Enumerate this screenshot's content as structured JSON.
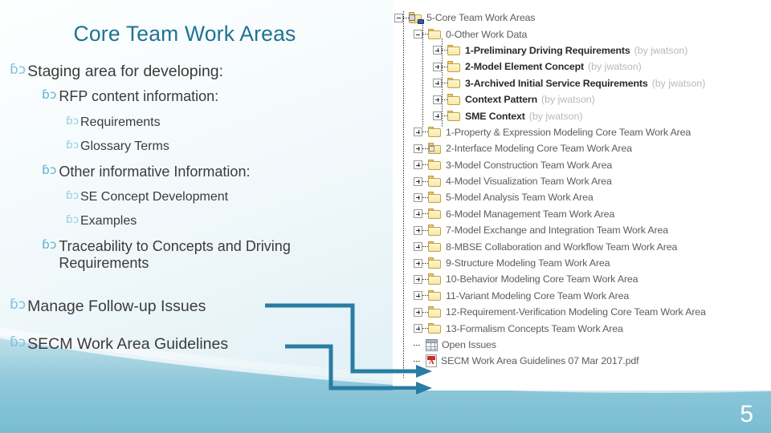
{
  "slide": {
    "title": "Core Team Work Areas",
    "page_number": "5",
    "bullet_glyph": "ɓↄ",
    "accent_color": "#1f7391",
    "connector_color": "#2a7ca3"
  },
  "outline": [
    {
      "level": 1,
      "text": "Staging area for developing:"
    },
    {
      "level": 2,
      "text": "RFP content information:"
    },
    {
      "level": 3,
      "text": "Requirements"
    },
    {
      "level": 3,
      "text": "Glossary Terms"
    },
    {
      "level": 2,
      "text": "Other informative Information:"
    },
    {
      "level": 3,
      "text": "SE Concept Development"
    },
    {
      "level": 3,
      "text": "Examples"
    },
    {
      "level": 2,
      "text": "Traceability to Concepts and Driving Requirements"
    },
    {
      "level": 1,
      "text": "Manage Follow-up Issues"
    },
    {
      "level": 1,
      "text": "SECM Work Area Guidelines"
    }
  ],
  "tree": {
    "rows": [
      {
        "indent": 0,
        "toggle": "minus",
        "icon": "folder-root",
        "label": "5-Core Team Work Areas",
        "by": "",
        "bold": false
      },
      {
        "indent": 1,
        "toggle": "minus",
        "icon": "folder",
        "label": "0-Other Work Data",
        "by": "",
        "bold": false
      },
      {
        "indent": 2,
        "toggle": "plus",
        "icon": "folder",
        "label": "1-Preliminary Driving Requirements",
        "by": "(by jwatson)",
        "bold": true
      },
      {
        "indent": 2,
        "toggle": "plus",
        "icon": "folder",
        "label": "2-Model Element Concept",
        "by": "(by jwatson)",
        "bold": true
      },
      {
        "indent": 2,
        "toggle": "plus",
        "icon": "folder",
        "label": "3-Archived Initial Service Requirements",
        "by": "(by jwatson)",
        "bold": true
      },
      {
        "indent": 2,
        "toggle": "plus",
        "icon": "folder",
        "label": "Context Pattern",
        "by": "(by jwatson)",
        "bold": true
      },
      {
        "indent": 2,
        "toggle": "plus",
        "icon": "folder",
        "label": "SME Context",
        "by": "(by jwatson)",
        "bold": true
      },
      {
        "indent": 1,
        "toggle": "plus",
        "icon": "folder",
        "label": "1-Property & Expression Modeling Core Team Work Area",
        "by": "",
        "bold": false
      },
      {
        "indent": 1,
        "toggle": "plus",
        "icon": "folder-special",
        "label": "2-Interface Modeling Core Team Work Area",
        "by": "",
        "bold": false
      },
      {
        "indent": 1,
        "toggle": "plus",
        "icon": "folder",
        "label": "3-Model Construction Team Work Area",
        "by": "",
        "bold": false
      },
      {
        "indent": 1,
        "toggle": "plus",
        "icon": "folder",
        "label": "4-Model Visualization Team Work Area",
        "by": "",
        "bold": false
      },
      {
        "indent": 1,
        "toggle": "plus",
        "icon": "folder",
        "label": "5-Model Analysis Team Work Area",
        "by": "",
        "bold": false
      },
      {
        "indent": 1,
        "toggle": "plus",
        "icon": "folder",
        "label": "6-Model Management Team Work Area",
        "by": "",
        "bold": false
      },
      {
        "indent": 1,
        "toggle": "plus",
        "icon": "folder",
        "label": "7-Model Exchange and Integration Team Work Area",
        "by": "",
        "bold": false
      },
      {
        "indent": 1,
        "toggle": "plus",
        "icon": "folder",
        "label": "8-MBSE Collaboration and Workflow Team Work Area",
        "by": "",
        "bold": false
      },
      {
        "indent": 1,
        "toggle": "plus",
        "icon": "folder",
        "label": "9-Structure Modeling Team Work Area",
        "by": "",
        "bold": false
      },
      {
        "indent": 1,
        "toggle": "plus",
        "icon": "folder",
        "label": "10-Behavior Modeling Core Team Work Area",
        "by": "",
        "bold": false
      },
      {
        "indent": 1,
        "toggle": "plus",
        "icon": "folder",
        "label": "11-Variant Modeling Core Team Work Area",
        "by": "",
        "bold": false
      },
      {
        "indent": 1,
        "toggle": "plus",
        "icon": "folder",
        "label": "12-Requirement-Verification Modeling Core Team Work Area",
        "by": "",
        "bold": false
      },
      {
        "indent": 1,
        "toggle": "plus",
        "icon": "folder",
        "label": "13-Formalism Concepts Team Work Area",
        "by": "",
        "bold": false
      },
      {
        "indent": 1,
        "toggle": "none",
        "icon": "spreadsheet",
        "label": "Open Issues",
        "by": "",
        "bold": false
      },
      {
        "indent": 1,
        "toggle": "none",
        "icon": "pdf",
        "label": "SECM Work Area Guidelines 07 Mar 2017.pdf",
        "by": "",
        "bold": false
      }
    ]
  },
  "connectors": [
    {
      "from": "Manage Follow-up Issues",
      "to": "Open Issues"
    },
    {
      "from": "SECM Work Area Guidelines",
      "to": "SECM Work Area Guidelines 07 Mar 2017.pdf"
    }
  ]
}
